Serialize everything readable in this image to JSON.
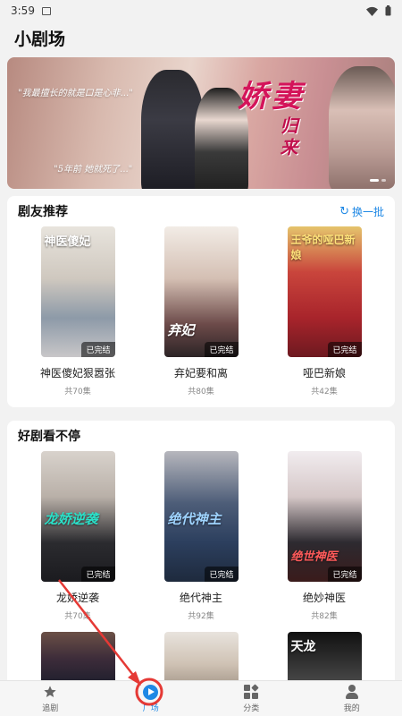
{
  "status_bar": {
    "time": "3:59"
  },
  "app": {
    "title": "小剧场"
  },
  "banner": {
    "quote_top": "\"我最擅长的就是口是心非...\"",
    "quote_bottom": "\"5年前 她就死了...\"",
    "title_main": "娇妻",
    "title_sub": "归来"
  },
  "section_recommend": {
    "title": "剧友推荐",
    "action_label": "换一批",
    "items": [
      {
        "title": "神医傻妃狠嚣张",
        "episodes": "共70集",
        "status": "已完结",
        "poster_text": "神医傻妃"
      },
      {
        "title": "弃妃要和离",
        "episodes": "共80集",
        "status": "已完结",
        "poster_text": "弃妃"
      },
      {
        "title": "哑巴新娘",
        "episodes": "共42集",
        "status": "已完结",
        "poster_text": "王爷的哑巴新娘"
      }
    ]
  },
  "section_binge": {
    "title": "好剧看不停",
    "items": [
      {
        "title": "龙娇逆袭",
        "episodes": "共70集",
        "status": "已完结",
        "poster_text": "龙娇逆袭"
      },
      {
        "title": "绝代神主",
        "episodes": "共92集",
        "status": "已完结",
        "poster_text": "绝代神主"
      },
      {
        "title": "绝妙神医",
        "episodes": "共82集",
        "status": "已完结",
        "poster_text": "绝世神医"
      }
    ],
    "partial_row": [
      {
        "poster_text": ""
      },
      {
        "poster_text": ""
      },
      {
        "poster_text": "天龙"
      }
    ]
  },
  "bottom_nav": {
    "items": [
      {
        "label": "追剧",
        "icon": "star-icon"
      },
      {
        "label": "广场",
        "icon": "play-icon",
        "active": true
      },
      {
        "label": "分类",
        "icon": "category-icon"
      },
      {
        "label": "我的",
        "icon": "user-icon"
      }
    ]
  },
  "colors": {
    "accent": "#1e88e5",
    "annotation": "#e53935"
  }
}
